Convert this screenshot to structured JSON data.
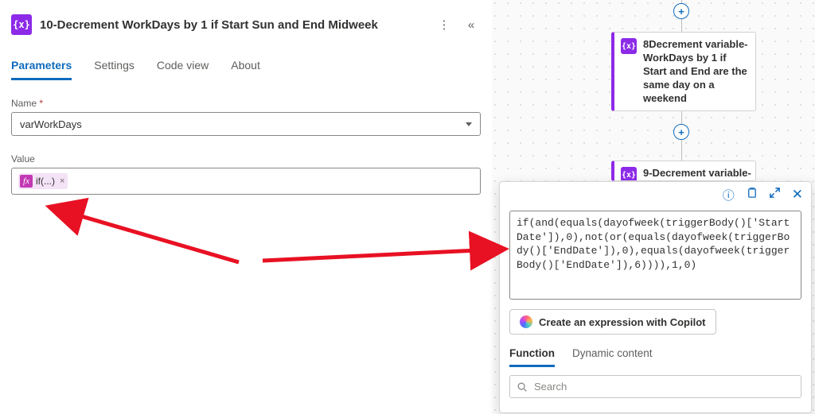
{
  "header": {
    "icon_text": "{x}",
    "title": "10-Decrement WorkDays by 1 if Start Sun and End Midweek"
  },
  "tabs": {
    "parameters": "Parameters",
    "settings": "Settings",
    "codeview": "Code view",
    "about": "About"
  },
  "fields": {
    "name_label": "Name",
    "name_value": "varWorkDays",
    "value_label": "Value",
    "token_icon": "fx",
    "token_text": "if(...)",
    "token_close": "×"
  },
  "canvas": {
    "card1_text": "8Decrement variable-WorkDays by 1 if Start and End are the same day on a weekend",
    "card2_text": "9-Decrement variable-",
    "icon_text": "{x}"
  },
  "popup": {
    "expression": "if(and(equals(dayofweek(triggerBody()['StartDate']),0),not(or(equals(dayofweek(triggerBody()['EndDate']),0),equals(dayofweek(triggerBody()['EndDate']),6)))),1,0)",
    "copilot_label": "Create an expression with Copilot",
    "tab_function": "Function",
    "tab_dynamic": "Dynamic content",
    "search_placeholder": "Search"
  }
}
